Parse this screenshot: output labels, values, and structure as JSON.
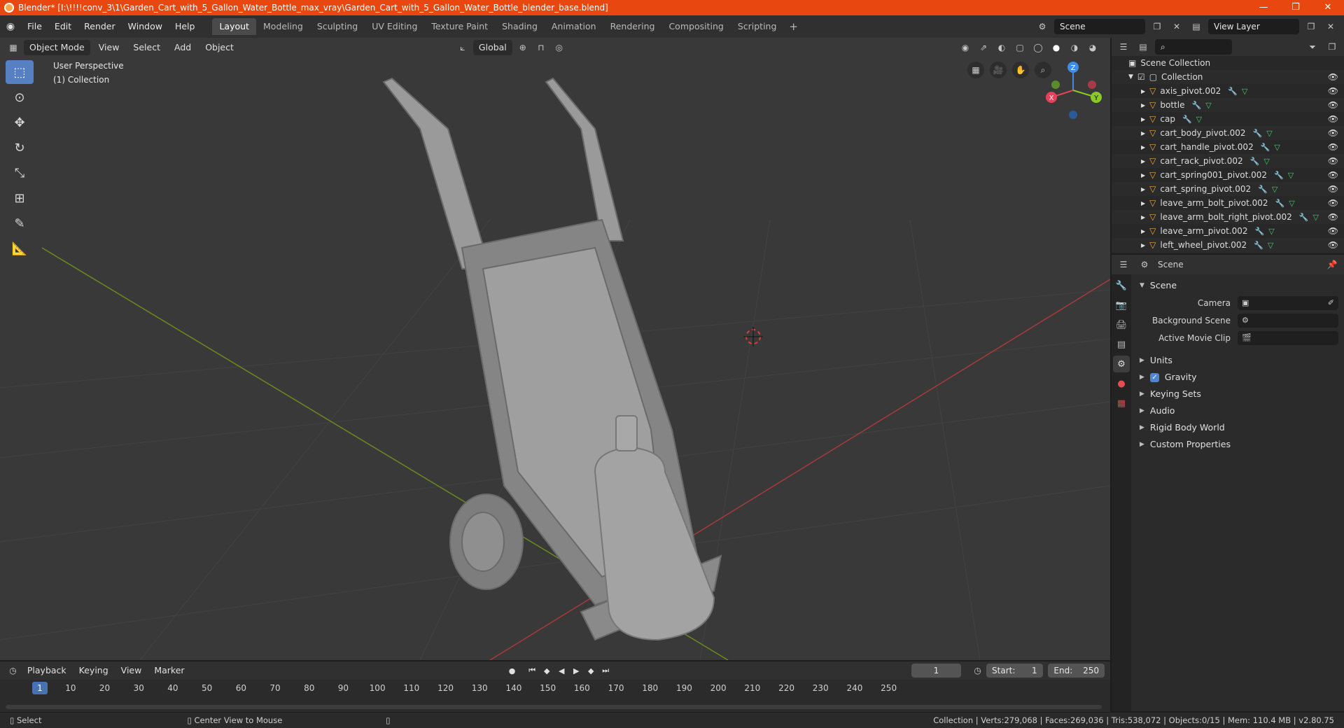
{
  "window": {
    "title": "Blender* [I:\\!!!!conv_3\\1\\Garden_Cart_with_5_Gallon_Water_Bottle_max_vray\\Garden_Cart_with_5_Gallon_Water_Bottle_blender_base.blend]",
    "controls": [
      "—",
      "❐",
      "✕"
    ]
  },
  "menubar": {
    "menus": [
      "File",
      "Edit",
      "Render",
      "Window",
      "Help"
    ],
    "workspaces": [
      {
        "label": "Layout",
        "active": true
      },
      {
        "label": "Modeling",
        "active": false
      },
      {
        "label": "Sculpting",
        "active": false
      },
      {
        "label": "UV Editing",
        "active": false
      },
      {
        "label": "Texture Paint",
        "active": false
      },
      {
        "label": "Shading",
        "active": false
      },
      {
        "label": "Animation",
        "active": false
      },
      {
        "label": "Rendering",
        "active": false
      },
      {
        "label": "Compositing",
        "active": false
      },
      {
        "label": "Scripting",
        "active": false
      }
    ],
    "scene": "Scene",
    "view_layer": "View Layer"
  },
  "viewport": {
    "mode": "Object Mode",
    "menus": [
      "View",
      "Select",
      "Add",
      "Object"
    ],
    "transform_orientation": "Global",
    "perspective_label": "User Perspective",
    "collection_label": "(1) Collection",
    "gizmo_axes": {
      "x": "X",
      "y": "Y",
      "z": "Z"
    }
  },
  "outliner": {
    "root": "Scene Collection",
    "collection": "Collection",
    "objects": [
      "axis_pivot.002",
      "bottle",
      "cap",
      "cart_body_pivot.002",
      "cart_handle_pivot.002",
      "cart_rack_pivot.002",
      "cart_spring001_pivot.002",
      "cart_spring_pivot.002",
      "leave_arm_bolt_pivot.002",
      "leave_arm_bolt_right_pivot.002",
      "leave_arm_pivot.002",
      "left_wheel_pivot.002"
    ]
  },
  "properties": {
    "context": "Scene",
    "panel_title": "Scene",
    "fields": [
      {
        "label": "Camera",
        "value": ""
      },
      {
        "label": "Background Scene",
        "value": ""
      },
      {
        "label": "Active Movie Clip",
        "value": ""
      }
    ],
    "subpanels": [
      "Units",
      "Gravity",
      "Keying Sets",
      "Audio",
      "Rigid Body World",
      "Custom Properties"
    ],
    "gravity_checked": true
  },
  "timeline": {
    "menus": [
      "Playback",
      "Keying",
      "View",
      "Marker"
    ],
    "current_frame": "1",
    "start_label": "Start:",
    "start": "1",
    "end_label": "End:",
    "end": "250",
    "ticks": [
      "10",
      "20",
      "30",
      "40",
      "50",
      "60",
      "70",
      "80",
      "90",
      "100",
      "110",
      "120",
      "130",
      "140",
      "150",
      "160",
      "170",
      "180",
      "190",
      "200",
      "210",
      "220",
      "230",
      "240",
      "250"
    ]
  },
  "statusbar": {
    "left_hint": "Select",
    "middle_hint": "Center View to Mouse",
    "stats": "Collection | Verts:279,068 | Faces:269,036 | Tris:538,072 | Objects:0/15 | Mem: 110.4 MB | v2.80.75"
  },
  "colors": {
    "titlebar": "#e8470f",
    "accent": "#4772b3",
    "mesh_icon": "#f5a445",
    "axis_x": "#e8405a",
    "axis_y": "#8ac926",
    "axis_z": "#3f8ce8"
  }
}
